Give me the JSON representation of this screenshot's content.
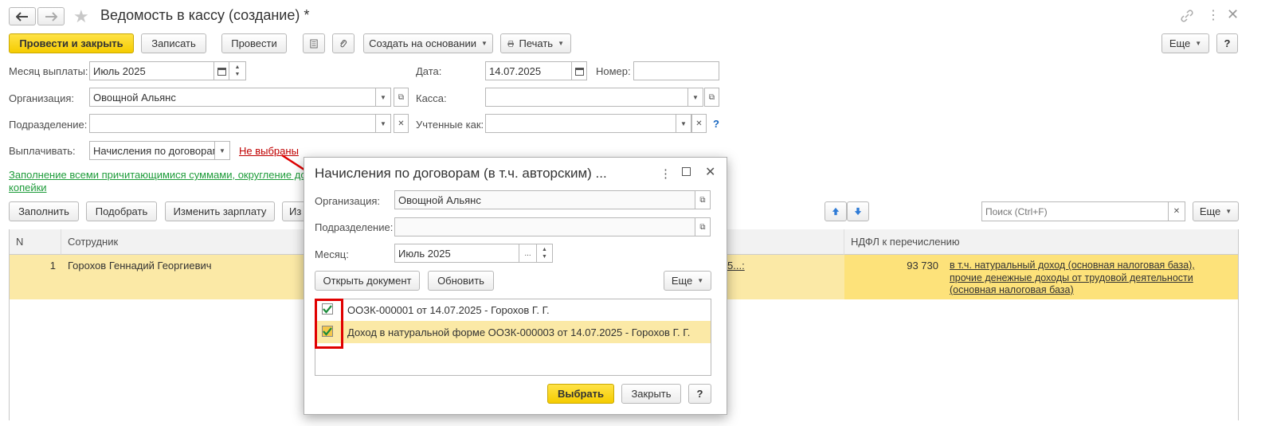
{
  "window": {
    "title": "Ведомость в кассу (создание) *"
  },
  "toolbar": {
    "post_close": "Провести и закрыть",
    "save": "Записать",
    "post": "Провести",
    "create_based": "Создать на основании",
    "print": "Печать",
    "more": "Еще",
    "help": "?"
  },
  "form": {
    "month_label": "Месяц выплаты:",
    "month_value": "Июль 2025",
    "date_label": "Дата:",
    "date_value": "14.07.2025",
    "number_label": "Номер:",
    "number_value": "",
    "org_label": "Организация:",
    "org_value": "Овощной Альянс",
    "cash_label": "Касса:",
    "cash_value": "",
    "dept_label": "Подразделение:",
    "dept_value": "",
    "accounted_label": "Учтенные как:",
    "accounted_value": "",
    "accounted_help": "?",
    "pay_label": "Выплачивать:",
    "pay_value": "Начисления по договорам",
    "not_selected": "Не выбраны",
    "fill_info_line1": "Заполнение всеми причитающимися суммами, округление до",
    "fill_info_line2": "копейки"
  },
  "table_toolbar": {
    "fill": "Заполнить",
    "pick": "Подобрать",
    "change_salary": "Изменить зарплату",
    "partial": "Из",
    "search_placeholder": "Поиск (Ctrl+F)",
    "more": "Еще"
  },
  "table": {
    "columns": {
      "n": "N",
      "employee": "Сотрудник",
      "ndfl": "НДФЛ к перечислению"
    },
    "rows": [
      {
        "n": "1",
        "employee": "Горохов Геннадий Георгиевич",
        "partial_link": "5...:",
        "ndfl": "93 730",
        "ndfl_note_1": "в т.ч. натуральный доход (основная налоговая база),",
        "ndfl_note_2": "прочие денежные доходы от трудовой деятельности",
        "ndfl_note_3": "(основная налоговая база)"
      }
    ]
  },
  "dialog": {
    "title": "Начисления по договорам (в т.ч. авторским) ...",
    "org_label": "Организация:",
    "org_value": "Овощной Альянс",
    "dept_label": "Подразделение:",
    "dept_value": "",
    "month_label": "Месяц:",
    "month_value": "Июль 2025",
    "open_doc": "Открыть документ",
    "refresh": "Обновить",
    "more": "Еще",
    "items": [
      {
        "label": "ООЗК-000001 от 14.07.2025 - Горохов Г. Г.",
        "checked": true
      },
      {
        "label": "Доход в натуральной форме ООЗК-000003 от 14.07.2025 - Горохов Г. Г.",
        "checked": true
      }
    ],
    "select": "Выбрать",
    "close": "Закрыть",
    "help": "?"
  },
  "colors": {
    "accent_yellow": "#f5cc00",
    "row_highlight": "#fbe9a6",
    "link_red": "#c00000",
    "link_green": "#1e9c3a",
    "annotation_red": "#e00000"
  }
}
